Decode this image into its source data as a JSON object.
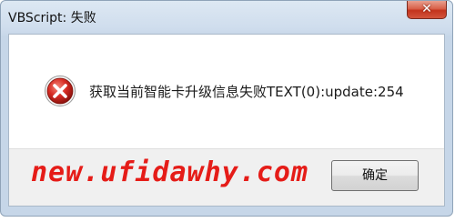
{
  "window": {
    "title": "VBScript: 失败"
  },
  "titlebar": {
    "close_icon": "close-icon"
  },
  "dialog": {
    "icon": "error-icon",
    "message": "获取当前智能卡升级信息失败TEXT(0):update:254"
  },
  "footer": {
    "watermark": "new.ufidawhy.com",
    "ok_label": "确定"
  },
  "colors": {
    "error_red": "#d62a22",
    "watermark_red": "#e51c18",
    "close_button_red": "#c3331c",
    "titlebar_blue": "#cfdded"
  }
}
